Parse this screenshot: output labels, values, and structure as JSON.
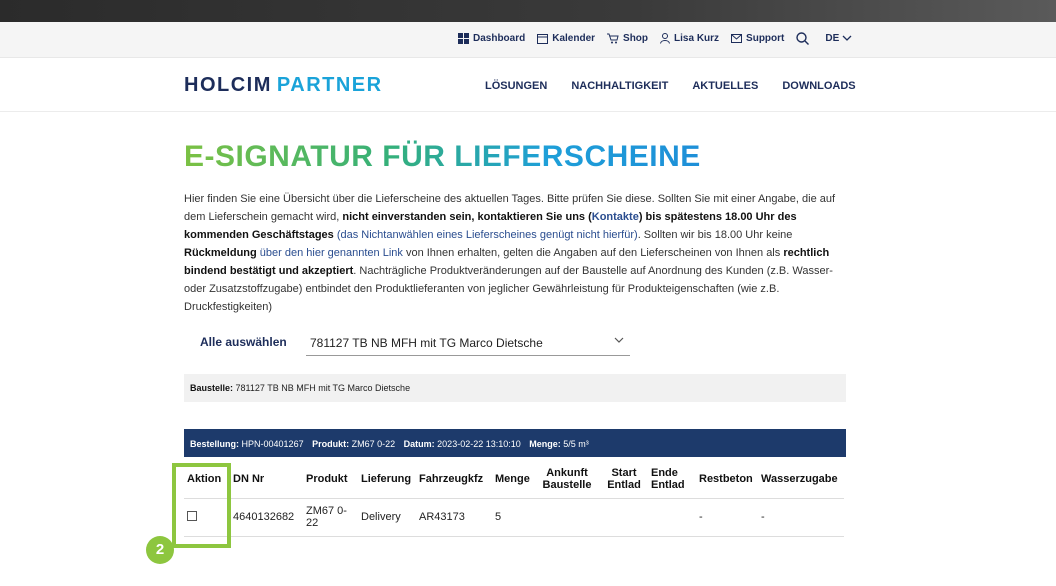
{
  "utility": {
    "dashboard": "Dashboard",
    "kalender": "Kalender",
    "shop": "Shop",
    "user": "Lisa Kurz",
    "support": "Support",
    "lang": "DE"
  },
  "brand": {
    "holcim": "HOLCIM",
    "partner": "PARTNER"
  },
  "nav": [
    "LÖSUNGEN",
    "NACHHALTIGKEIT",
    "AKTUELLES",
    "DOWNLOADS"
  ],
  "page_title": "E-SIGNATUR FÜR LIEFERSCHEINE",
  "intro": {
    "t1": "Hier finden Sie eine Übersicht über die Lieferscheine des aktuellen Tages. Bitte prüfen Sie diese. Sollten Sie mit einer Angabe, die auf dem Lieferschein gemacht wird, ",
    "b1": "nicht einverstanden sein, kontaktieren Sie uns (",
    "link": "Kontakte",
    "b2": ") bis spätestens 18.00 Uhr des kommenden Geschäftstages",
    "t2": " (das Nichtanwählen eines Lieferscheines genügt nicht hierfür)",
    "t3": ". Sollten wir bis 18.00 Uhr keine ",
    "b3": "Rückmeldung",
    "t4": " über den hier genannten Link",
    "t5": " von Ihnen erhalten, gelten die Angaben auf den Lieferscheinen von Ihnen als ",
    "b4": "rechtlich bindend bestätigt und akzeptiert",
    "t6": ". Nachträgliche Produktveränderungen auf der Baustelle auf Anordnung des Kunden (z.B. Wasser- oder Zusatzstoffzugabe) entbindet den Produktlieferanten von jeglicher Gewährleistung für Produkteigenschaften (wie z.B. Druckfestigkeiten)"
  },
  "select_all": "Alle auswählen",
  "site_select": {
    "value": "781127 TB NB MFH mit TG Marco Dietsche"
  },
  "baustelle": {
    "label": "Baustelle:",
    "value": " 781127 TB NB MFH mit TG Marco Dietsche"
  },
  "order": {
    "bestellung_label": "Bestellung:",
    "bestellung_value": "HPN-00401267",
    "produkt_label": "Produkt:",
    "produkt_value": "ZM67 0-22",
    "datum_label": "Datum:",
    "datum_value": "2023-02-22 13:10:10",
    "menge_label": "Menge:",
    "menge_value": "5/5 m³"
  },
  "table": {
    "headers": {
      "aktion": "Aktion",
      "dn": "DN Nr",
      "produkt": "Produkt",
      "lieferung": "Lieferung",
      "fahrzeug": "Fahrzeugkfz",
      "menge": "Menge",
      "ankunft": "Ankunft Baustelle",
      "start": "Start Entlad",
      "ende": "Ende Entlad",
      "restbeton": "Restbeton",
      "wasser": "Wasserzugabe"
    },
    "rows": [
      {
        "dn": "4640132682",
        "produkt": "ZM67 0-22",
        "lieferung": "Delivery",
        "fahrzeug": "AR43173",
        "menge": "5",
        "ankunft": "",
        "start": "",
        "ende": "",
        "restbeton": "-",
        "wasser": "-"
      }
    ]
  },
  "annotation": {
    "step": "2",
    "color": "#8dc63f"
  },
  "colors": {
    "navy": "#1d2d5a",
    "accent": "#1aa3d9",
    "orderbar": "#1d3a6b"
  }
}
